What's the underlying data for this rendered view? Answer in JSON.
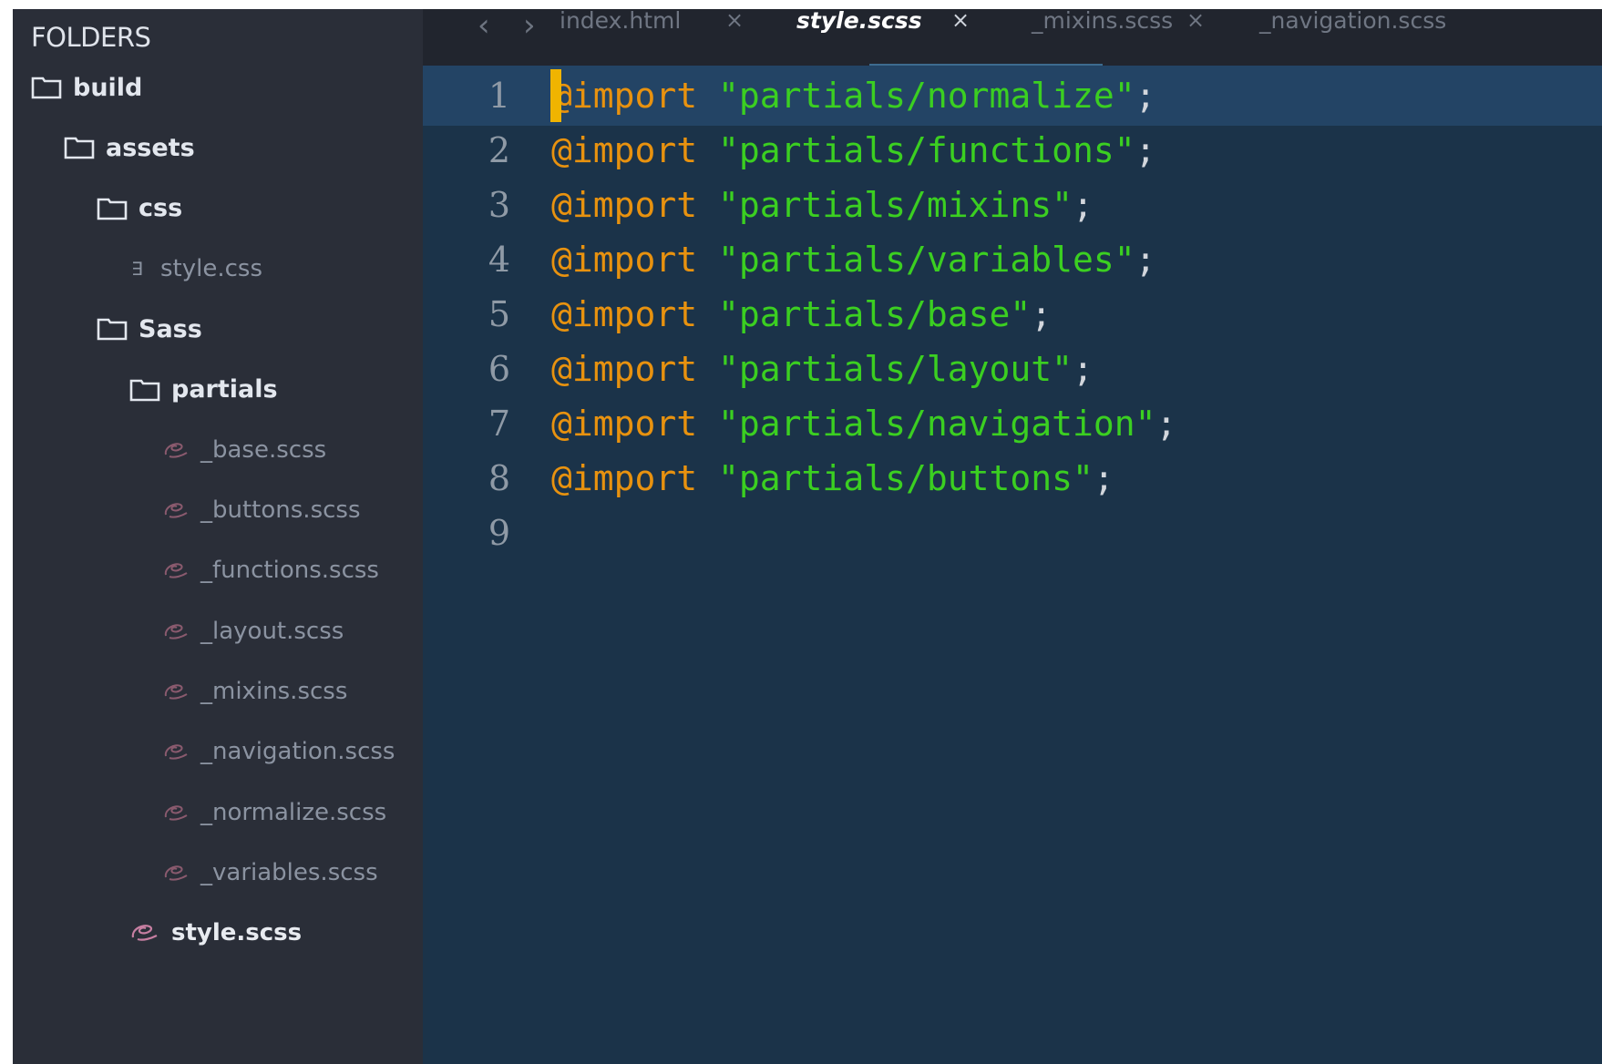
{
  "sidebar": {
    "title": "FOLDERS",
    "tree": [
      {
        "label": "build",
        "type": "folder",
        "depth": 0
      },
      {
        "label": "assets",
        "type": "folder",
        "depth": 1
      },
      {
        "label": "css",
        "type": "folder",
        "depth": 2
      },
      {
        "label": "style.css",
        "type": "css-file",
        "depth": 3
      },
      {
        "label": "Sass",
        "type": "folder",
        "depth": 2
      },
      {
        "label": "partials",
        "type": "folder",
        "depth": 3
      },
      {
        "label": "_base.scss",
        "type": "scss-file",
        "depth": 4
      },
      {
        "label": "_buttons.scss",
        "type": "scss-file",
        "depth": 4
      },
      {
        "label": "_functions.scss",
        "type": "scss-file",
        "depth": 4
      },
      {
        "label": "_layout.scss",
        "type": "scss-file",
        "depth": 4
      },
      {
        "label": "_mixins.scss",
        "type": "scss-file",
        "depth": 4
      },
      {
        "label": "_navigation.scss",
        "type": "scss-file",
        "depth": 4
      },
      {
        "label": "_normalize.scss",
        "type": "scss-file",
        "depth": 4
      },
      {
        "label": "_variables.scss",
        "type": "scss-file",
        "depth": 4
      },
      {
        "label": "style.scss",
        "type": "scss-file",
        "depth": 3,
        "highlight": true
      }
    ]
  },
  "tabs": [
    {
      "label": "index.html",
      "close": "×",
      "active": false
    },
    {
      "label": "style.scss",
      "close": "×",
      "active": true
    },
    {
      "label": "_mixins.scss",
      "close": "×",
      "active": false
    },
    {
      "label": "_navigation.scss",
      "close": "",
      "active": false
    }
  ],
  "nav": {
    "back": "‹",
    "forward": "›"
  },
  "editor": {
    "current_line": 1,
    "lines": [
      {
        "num": "1",
        "keyword": "@import",
        "string": "\"partials/normalize\"",
        "end": ";"
      },
      {
        "num": "2",
        "keyword": "@import",
        "string": "\"partials/functions\"",
        "end": ";"
      },
      {
        "num": "3",
        "keyword": "@import",
        "string": "\"partials/mixins\"",
        "end": ";"
      },
      {
        "num": "4",
        "keyword": "@import",
        "string": "\"partials/variables\"",
        "end": ";"
      },
      {
        "num": "5",
        "keyword": "@import",
        "string": "\"partials/base\"",
        "end": ";"
      },
      {
        "num": "6",
        "keyword": "@import",
        "string": "\"partials/layout\"",
        "end": ";"
      },
      {
        "num": "7",
        "keyword": "@import",
        "string": "\"partials/navigation\"",
        "end": ";"
      },
      {
        "num": "8",
        "keyword": "@import",
        "string": "\"partials/buttons\"",
        "end": ";"
      },
      {
        "num": "9",
        "keyword": "",
        "string": "",
        "end": ""
      }
    ]
  },
  "colors": {
    "keyword": "#e8920f",
    "string": "#3bcf21",
    "editor_bg": "#1b3349",
    "current_line_bg": "#234465",
    "sidebar_bg": "#2a2e38"
  }
}
